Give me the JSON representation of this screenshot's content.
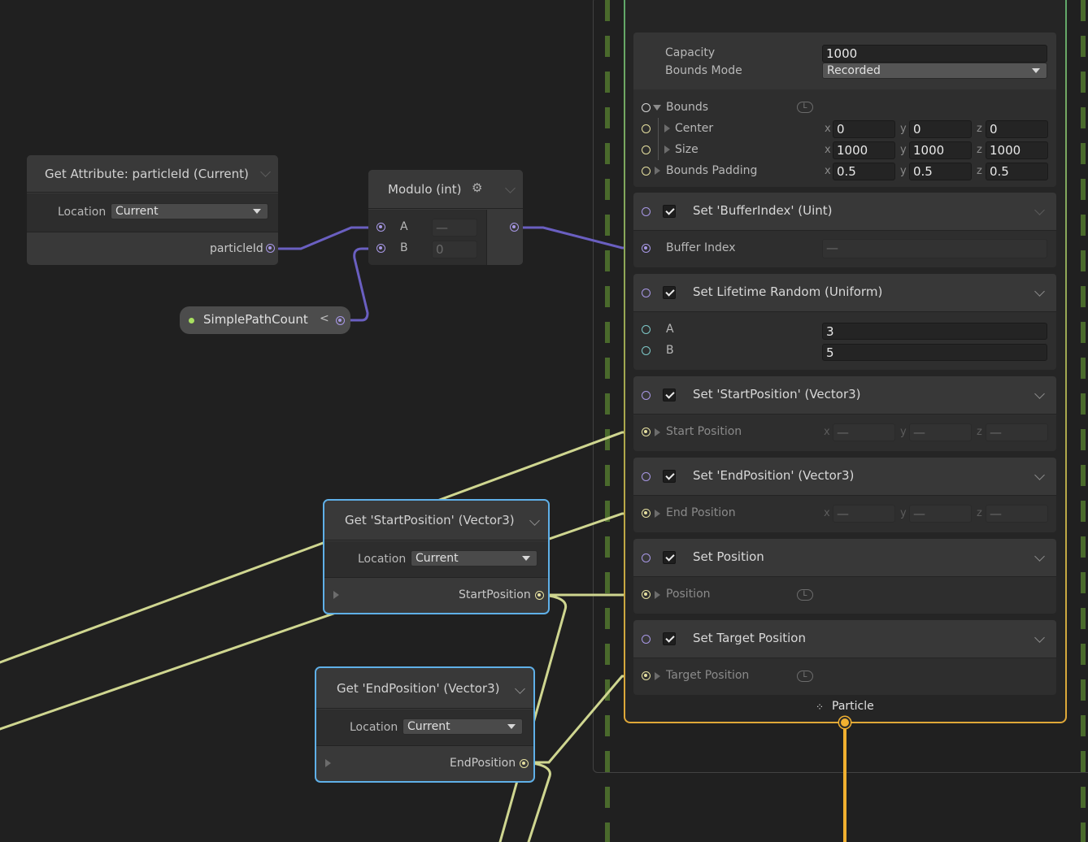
{
  "nodes": {
    "get_particle_id": {
      "title": "Get Attribute: particleId (Current)",
      "location_label": "Location",
      "location_value": "Current",
      "output_label": "particleId"
    },
    "modulo": {
      "title": "Modulo (int)",
      "input_a_label": "A",
      "input_a_value": "—",
      "input_b_label": "B",
      "input_b_value": "0"
    },
    "simple_path_count": {
      "label": "SimplePathCount",
      "arrow": "<"
    },
    "get_start_position": {
      "title": "Get 'StartPosition' (Vector3)",
      "location_label": "Location",
      "location_value": "Current",
      "output_label": "StartPosition"
    },
    "get_end_position": {
      "title": "Get 'EndPosition' (Vector3)",
      "location_label": "Location",
      "location_value": "Current",
      "output_label": "EndPosition"
    }
  },
  "context": {
    "capacity_label": "Capacity",
    "capacity_value": "1000",
    "bounds_mode_label": "Bounds Mode",
    "bounds_mode_value": "Recorded",
    "bounds_label": "Bounds",
    "center_label": "Center",
    "center": {
      "x": "0",
      "y": "0",
      "z": "0"
    },
    "size_label": "Size",
    "size": {
      "x": "1000",
      "y": "1000",
      "z": "1000"
    },
    "bounds_padding_label": "Bounds Padding",
    "bounds_padding": {
      "x": "0.5",
      "y": "0.5",
      "z": "0.5"
    },
    "footer_label": "Particle",
    "local_badge": "L",
    "axis_labels": {
      "x": "x",
      "y": "y",
      "z": "z"
    },
    "empty_value": "—"
  },
  "blocks": {
    "buffer_index": {
      "title": "Set 'BufferIndex'  (Uint)",
      "port_label": "Buffer Index",
      "value": "—"
    },
    "lifetime": {
      "title": "Set Lifetime Random (Uniform)",
      "a_label": "A",
      "a_value": "3",
      "b_label": "B",
      "b_value": "5"
    },
    "start_position": {
      "title": "Set 'StartPosition'  (Vector3)",
      "port_label": "Start Position"
    },
    "end_position": {
      "title": "Set 'EndPosition'  (Vector3)",
      "port_label": "End Position"
    },
    "position": {
      "title": "Set Position",
      "port_label": "Position"
    },
    "target_position": {
      "title": "Set Target Position",
      "port_label": "Target Position"
    }
  },
  "colors": {
    "int_wire": "#6a5fc1",
    "vector_wire": "#cfd690",
    "context_top": "#5fa86a",
    "context_bottom": "#e0a838",
    "selection": "#5fb0e8",
    "particle_flow": "#f0b030",
    "event_dash": "#4a6a2c"
  }
}
